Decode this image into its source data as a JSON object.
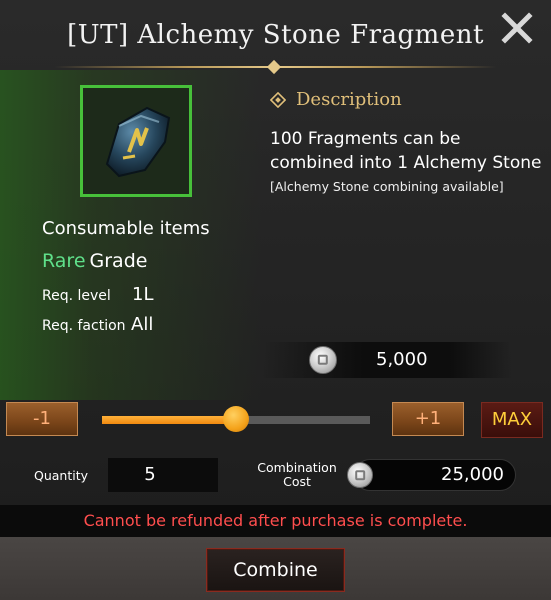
{
  "header": {
    "title": "[UT] Alchemy Stone Fragment",
    "close_icon": "close-icon"
  },
  "item": {
    "icon": "alchemy-stone-fragment-icon",
    "category": "Consumable items",
    "grade_name": "Rare",
    "grade_word": "Grade",
    "req_level_label": "Req. level",
    "req_level_value": "1L",
    "req_faction_label": "Req. faction",
    "req_faction_value": "All"
  },
  "description": {
    "heading": "Description",
    "line1": "100 Fragments can be",
    "line2": "combined into 1 Alchemy Stone",
    "note": "[Alchemy Stone combining available]",
    "unit_price": "5,000",
    "currency_icon": "silver-coin-icon"
  },
  "slider": {
    "minus_label": "-1",
    "plus_label": "+1",
    "max_label": "MAX",
    "level_fraction": 0.5
  },
  "purchase": {
    "quantity_label": "Quantity",
    "quantity_value": "5",
    "cost_label_line1": "Combination",
    "cost_label_line2": "Cost",
    "cost_value": "25,000",
    "warning": "Cannot be refunded after purchase is complete.",
    "combine_label": "Combine"
  },
  "colors": {
    "rare": "#5fe08a",
    "accent_gold": "#e0bf7a",
    "warning": "#ff4e4e",
    "max_text": "#ffcf3a"
  }
}
